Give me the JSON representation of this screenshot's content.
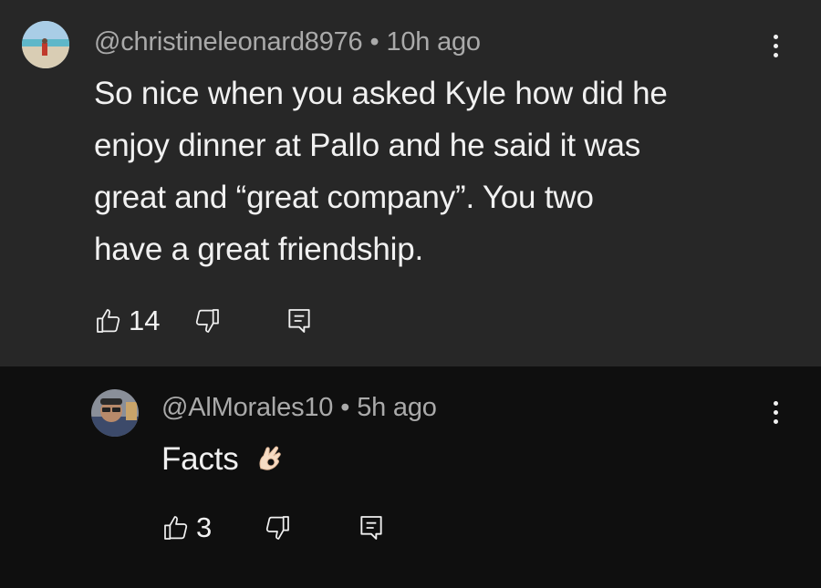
{
  "comments": [
    {
      "handle": "@christineleonard8976",
      "separator": "•",
      "time": "10h ago",
      "text_lines": [
        "So nice when you asked Kyle how did he",
        "enjoy dinner at Pallo and he said it was",
        "great and “great company”.   You two",
        "have a great friendship."
      ],
      "likes": "14",
      "icons": [
        "avatar",
        "more-vert-icon",
        "thumb-up-icon",
        "thumb-down-icon",
        "reply-icon"
      ]
    },
    {
      "handle": "@AlMorales10",
      "separator": "•",
      "time": "5h ago",
      "text": "Facts",
      "emoji": "ok-hand-emoji",
      "likes": "3",
      "icons": [
        "avatar",
        "more-vert-icon",
        "thumb-up-icon",
        "thumb-down-icon",
        "reply-icon"
      ]
    }
  ],
  "colors": {
    "parent_bg": "#272727",
    "reply_bg": "#0f0f0f",
    "meta_text": "#aaaaaa",
    "body_text": "#f1f1f1"
  }
}
